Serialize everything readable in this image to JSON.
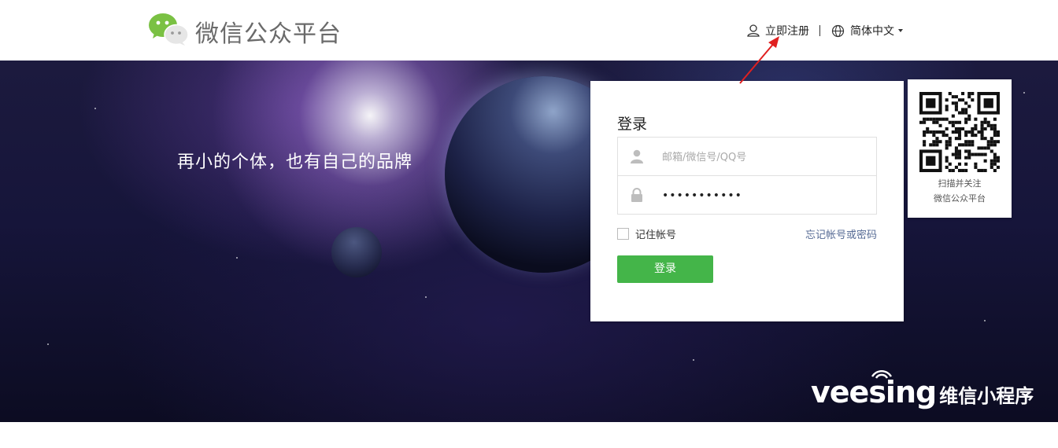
{
  "header": {
    "brand": "微信公众平台",
    "register_label": "立即注册",
    "language_label": "简体中文"
  },
  "banner": {
    "slogan": "再小的个体，也有自己的品牌"
  },
  "login": {
    "title": "登录",
    "account_placeholder": "邮箱/微信号/QQ号",
    "password_value": "•••••••••••",
    "remember_label": "记住帐号",
    "forgot_label": "忘记帐号或密码",
    "submit_label": "登录"
  },
  "qr": {
    "caption_line1": "扫描并关注",
    "caption_line2": "微信公众平台"
  },
  "watermark": {
    "latin": "veesing",
    "chinese": "维信小程序"
  },
  "colors": {
    "primary_green": "#44b549",
    "link_blue": "#576b95",
    "annotation_red": "#e02020"
  },
  "icons": [
    "wechat-logo-icon",
    "user-icon",
    "globe-icon",
    "chevron-down-icon",
    "lock-icon",
    "qr-code-icon",
    "wifi-icon",
    "arrow-annotation-icon"
  ]
}
